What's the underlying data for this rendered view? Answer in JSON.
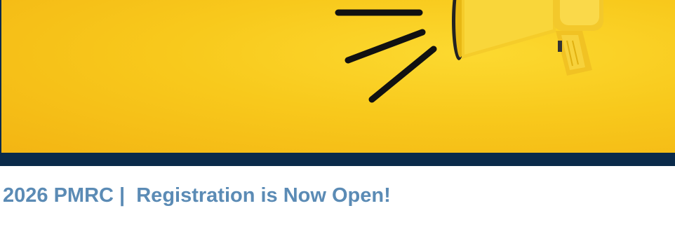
{
  "banner": {
    "image_icon": "megaphone-icon"
  },
  "headline": {
    "text": "2026 PMRC |  Registration is Now Open!"
  },
  "colors": {
    "banner_strip": "#0a2a4a",
    "banner_yellow": "#f8c91c",
    "headline": "#5b8bb5"
  }
}
